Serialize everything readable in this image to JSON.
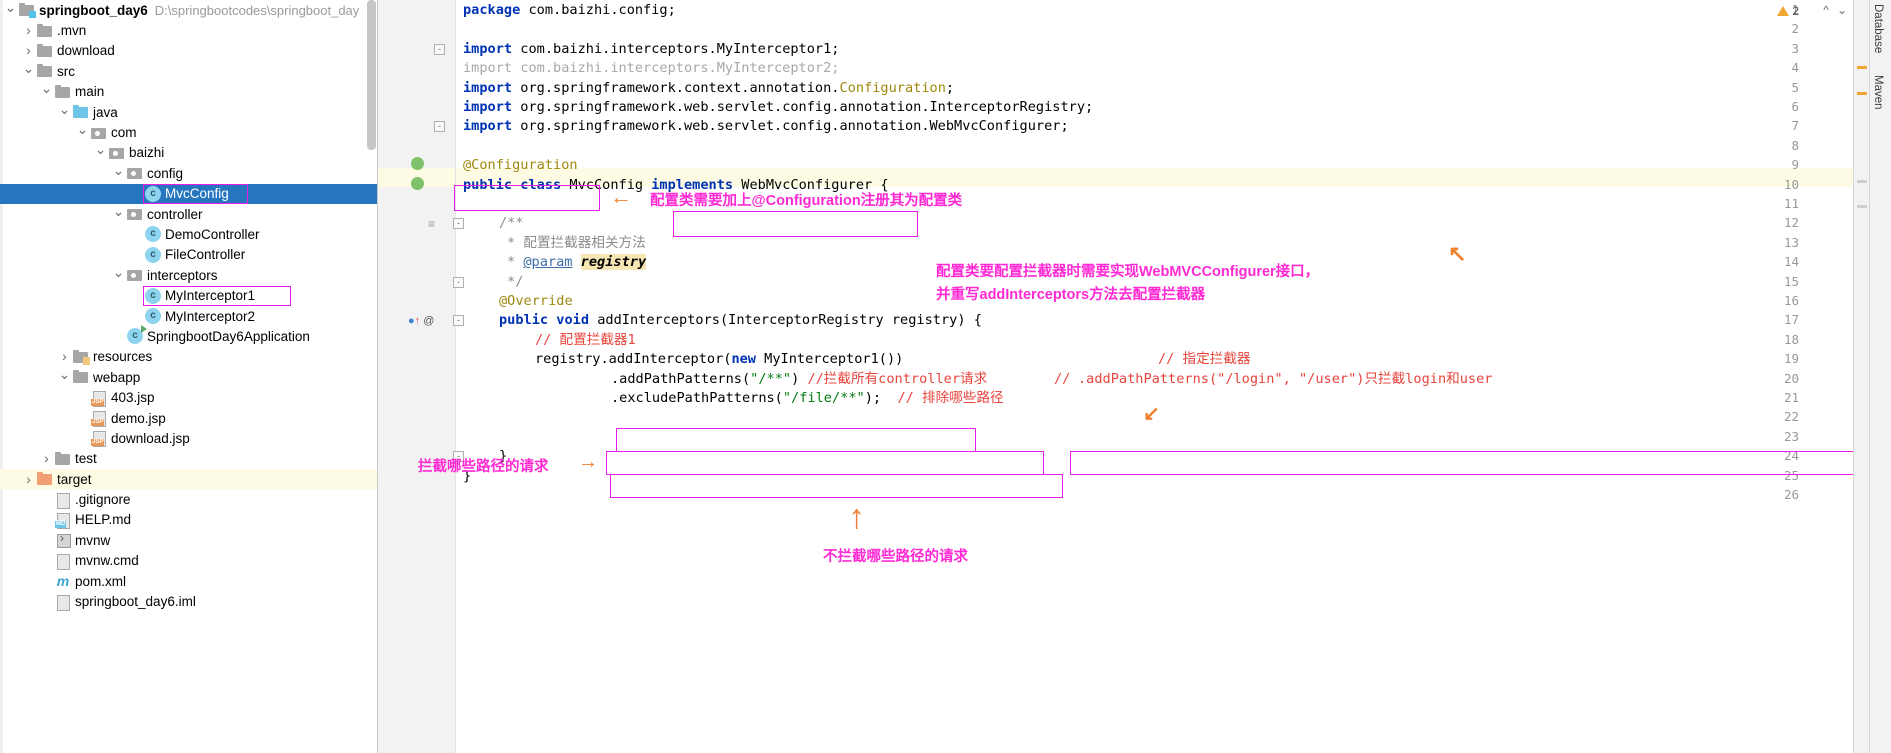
{
  "project": {
    "root_label": "springboot_day6",
    "root_path": "D:\\springbootcodes\\springboot_day",
    "items": [
      {
        "label": ".mvn",
        "icon": "folder-icon",
        "indent": 1,
        "arrow": "right"
      },
      {
        "label": "download",
        "icon": "folder-icon",
        "indent": 1,
        "arrow": "right"
      },
      {
        "label": "src",
        "icon": "folder-icon",
        "indent": 1,
        "arrow": "down"
      },
      {
        "label": "main",
        "icon": "folder-icon",
        "indent": 2,
        "arrow": "down"
      },
      {
        "label": "java",
        "icon": "folder-blue-icon",
        "indent": 3,
        "arrow": "down"
      },
      {
        "label": "com",
        "icon": "package-icon",
        "indent": 4,
        "arrow": "down"
      },
      {
        "label": "baizhi",
        "icon": "package-icon",
        "indent": 5,
        "arrow": "down"
      },
      {
        "label": "config",
        "icon": "package-icon",
        "indent": 6,
        "arrow": "down"
      },
      {
        "label": "MvcConfig",
        "icon": "java-class-icon",
        "indent": 7,
        "arrow": "none",
        "selected": true,
        "boxed": true
      },
      {
        "label": "controller",
        "icon": "package-icon",
        "indent": 6,
        "arrow": "down"
      },
      {
        "label": "DemoController",
        "icon": "java-class-icon",
        "indent": 7,
        "arrow": "none"
      },
      {
        "label": "FileController",
        "icon": "java-class-icon",
        "indent": 7,
        "arrow": "none"
      },
      {
        "label": "interceptors",
        "icon": "package-icon",
        "indent": 6,
        "arrow": "down"
      },
      {
        "label": "MyInterceptor1",
        "icon": "java-class-icon",
        "indent": 7,
        "arrow": "none",
        "boxed": true
      },
      {
        "label": "MyInterceptor2",
        "icon": "java-class-icon",
        "indent": 7,
        "arrow": "none"
      },
      {
        "label": "SpringbootDay6Application",
        "icon": "java-runnable-class-icon",
        "indent": 6,
        "arrow": "none"
      },
      {
        "label": "resources",
        "icon": "folder-resources-icon",
        "indent": 3,
        "arrow": "right"
      },
      {
        "label": "webapp",
        "icon": "folder-icon",
        "indent": 3,
        "arrow": "down"
      },
      {
        "label": "403.jsp",
        "icon": "jsp-file-icon",
        "indent": 4,
        "arrow": "none"
      },
      {
        "label": "demo.jsp",
        "icon": "jsp-file-icon",
        "indent": 4,
        "arrow": "none"
      },
      {
        "label": "download.jsp",
        "icon": "jsp-file-icon",
        "indent": 4,
        "arrow": "none"
      },
      {
        "label": "test",
        "icon": "folder-icon",
        "indent": 2,
        "arrow": "right"
      },
      {
        "label": "target",
        "icon": "folder-orange-icon",
        "indent": 1,
        "arrow": "right",
        "highlight": true
      },
      {
        "label": ".gitignore",
        "icon": "gitignore-file-icon",
        "indent": 2,
        "arrow": "none"
      },
      {
        "label": "HELP.md",
        "icon": "markdown-file-icon",
        "indent": 2,
        "arrow": "none"
      },
      {
        "label": "mvnw",
        "icon": "script-file-icon",
        "indent": 2,
        "arrow": "none"
      },
      {
        "label": "mvnw.cmd",
        "icon": "cmd-file-icon",
        "indent": 2,
        "arrow": "none"
      },
      {
        "label": "pom.xml",
        "icon": "maven-file-icon",
        "indent": 2,
        "arrow": "none"
      },
      {
        "label": "springboot_day6.iml",
        "icon": "iml-file-icon",
        "indent": 2,
        "arrow": "none"
      }
    ]
  },
  "editor": {
    "warning_count": "2",
    "line_numbers": [
      "1",
      "2",
      "3",
      "4",
      "5",
      "6",
      "7",
      "8",
      "9",
      "10",
      "11",
      "12",
      "13",
      "14",
      "15",
      "16",
      "17",
      "18",
      "19",
      "20",
      "21",
      "22",
      "23",
      "24",
      "25",
      "26"
    ],
    "code": {
      "l1": "package com.baizhi.config;",
      "l3": "import com.baizhi.interceptors.MyInterceptor1;",
      "l4": "import com.baizhi.interceptors.MyInterceptor2;",
      "l5": "import org.springframework.context.annotation.Configuration;",
      "l6": "import org.springframework.web.servlet.config.annotation.InterceptorRegistry;",
      "l7": "import org.springframework.web.servlet.config.annotation.WebMvcConfigurer;",
      "l9": "@Configuration",
      "l10_a": "public class MvcConfig ",
      "l10_b": "implements WebMvcConfigurer",
      "l10_c": " {",
      "l12": "/**",
      "l13": "* 配置拦截器相关方法",
      "l14_a": "* ",
      "l14_b": "@param",
      "l14_c": " registry",
      "l15": "*/",
      "l16": "@Override",
      "l17": "public void addInterceptors(InterceptorRegistry registry) {",
      "l18": "// 配置拦截器1",
      "l19_a": "registry.",
      "l19_b": "addInterceptor(new MyInterceptor1())",
      "l19_c": "   // 指定拦截器",
      "l20_a": ".addPathPatterns(\"/**\") //拦截所有controller请求",
      "l20_b": " // ",
      "l20_c": ".addPathPatterns(\"/login\", \"/user\")只拦截login和user",
      "l21": ".excludePathPatterns(\"/file/**\");  // 排除哪些路径",
      "l24": "}",
      "l25": "}"
    },
    "annotations": [
      {
        "id": "ann-configuration",
        "text": "配置类需要加上@Configuration注册其为配置类"
      },
      {
        "id": "ann-webmvc-1",
        "text": "配置类要配置拦截器时需要实现WebMVCConfigurer接口，"
      },
      {
        "id": "ann-webmvc-2",
        "text": "并重写addInterceptors方法去配置拦截器"
      },
      {
        "id": "ann-specify",
        "text": "指定拦截器"
      },
      {
        "id": "ann-paths",
        "text": "拦截哪些路径的请求"
      },
      {
        "id": "ann-not-intercept",
        "text": "不拦截哪些路径的请求"
      }
    ]
  },
  "right_panels": {
    "tabs": [
      {
        "label": "Database"
      },
      {
        "label": "Maven"
      }
    ]
  },
  "colors": {
    "selection": "#2675bf",
    "box_magenta": "#e81ee8",
    "note_pink": "#ff2ad4",
    "arrow_orange": "#f08030",
    "keyword_blue": "#0033b3",
    "annotation_olive": "#9e880d",
    "string_green": "#067d17",
    "comment_grey": "#8c8c8c",
    "comment_red": "#e8453c",
    "target_highlight": "#fdfbe3"
  }
}
